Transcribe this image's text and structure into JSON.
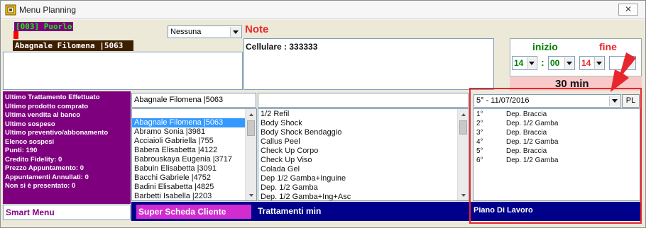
{
  "window": {
    "title": "Menu Planning",
    "close_glyph": "✕"
  },
  "header": {
    "operator_code": "[003] Puorlo",
    "client_name": "Abagnale Filomena |5063",
    "filter_select": "Nessuna",
    "note_label": "Note",
    "note_text": "Cellulare : 333333"
  },
  "time": {
    "start_label": "inizio",
    "end_label": "fine",
    "start_hour": "14",
    "start_min": "00",
    "end_hour": "14",
    "separator": ":",
    "duration": "30 min"
  },
  "stats": [
    "Ultimo Trattamento Effettuato",
    "Ultimo prodotto comprato",
    "Ultima vendita al banco",
    "Ultimo sospeso",
    "Ultimo preventivo/abbonamento",
    "Elenco sospesi",
    "Punti: 190",
    "Credito Fidelity: 0",
    "Prezzo Appuntamento: 0",
    "Appuntamenti Annullati: 0",
    "Non si è presentato: 0"
  ],
  "client_list": {
    "search_value": "Abagnale Filomena |5063",
    "items": [
      "Abagnale Filomena |5063",
      "Abramo Sonia |3981",
      "Acciaioli Gabriella |755",
      "Babera Elisabetta |4122",
      "Babrouskaya Eugenia |3717",
      "Babuin Elisabetta |3091",
      "Bacchi Gabriele |4752",
      "Badini Elisabetta |4825",
      "Barbetti Isabella |2203"
    ],
    "selected_index": 0
  },
  "treatments": {
    "search_value": "",
    "items": [
      "1/2 Refil",
      "Body Shock",
      "Body Shock Bendaggio",
      "Callus Peel",
      "Check Up Corpo",
      "Check Up Viso",
      "Colada Gel",
      "Dep 1/2 Gamba+Inguine",
      "Dep. 1/2 Gamba",
      "Dep. 1/2 Gamba+Ing+Asc"
    ]
  },
  "plan": {
    "select_value": "5° - 11/07/2016",
    "pl_button": "PL",
    "rows": [
      {
        "num": "1°",
        "name": "Dep. Braccia"
      },
      {
        "num": "2°",
        "name": "Dep. 1/2 Gamba"
      },
      {
        "num": "3°",
        "name": "Dep. Braccia"
      },
      {
        "num": "4°",
        "name": "Dep. 1/2 Gamba"
      },
      {
        "num": "5°",
        "name": "Dep. Braccia"
      },
      {
        "num": "6°",
        "name": "Dep. 1/2 Gamba"
      }
    ]
  },
  "footer": {
    "smart_menu": "Smart Menu",
    "super_scheda": "Super Scheda Cliente",
    "trattamenti": "Trattamenti min",
    "piano": "Piano Di Lavoro"
  },
  "colors": {
    "purple": "#7f007f",
    "navy": "#00008b",
    "accent_red": "#e8262e",
    "green_time": "#008000",
    "selection_blue": "#3399ff"
  }
}
